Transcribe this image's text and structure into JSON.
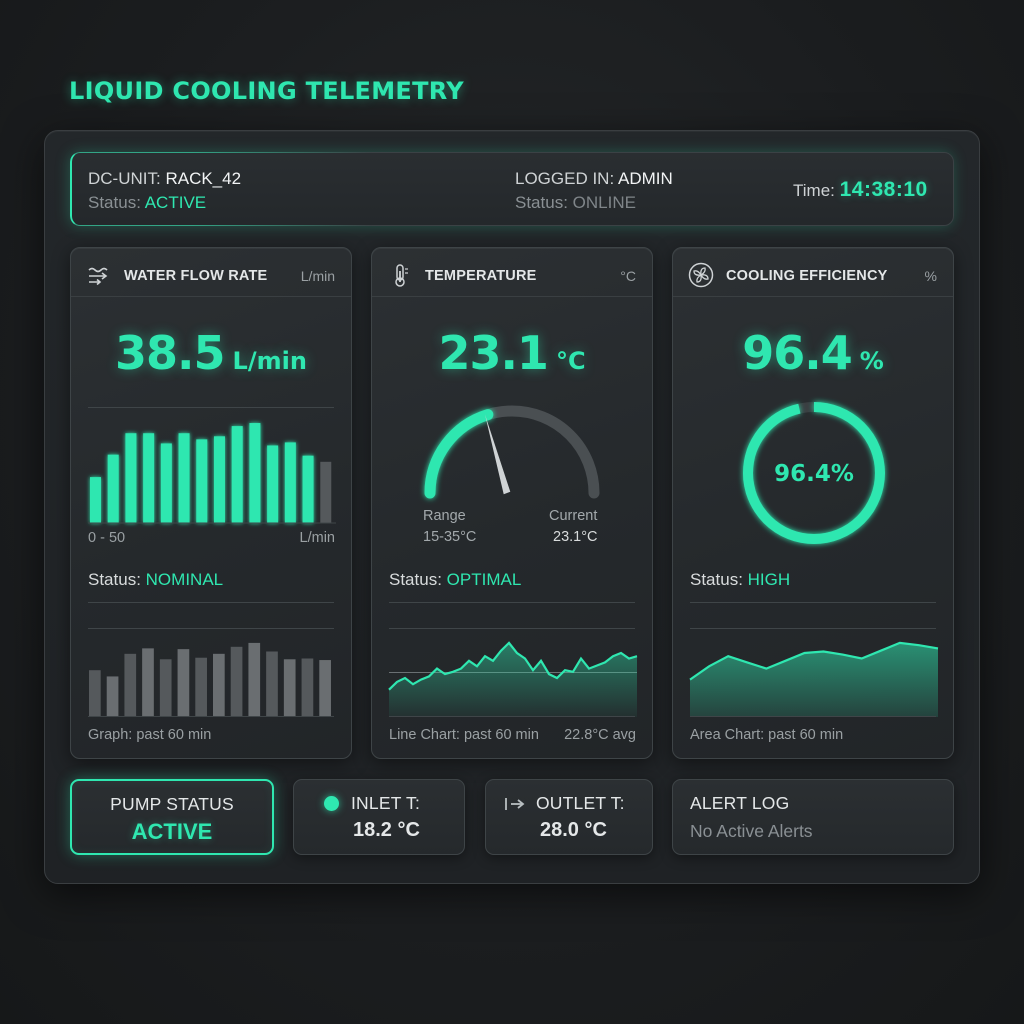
{
  "app": {
    "title": "LIQUID COOLING TELEMETRY"
  },
  "header": {
    "unit_label": "DC-UNIT:",
    "unit_value": "RACK_42",
    "status_label": "Status:",
    "status_value": "ACTIVE",
    "login_label": "LOGGED IN:",
    "login_value": "ADMIN",
    "login_status_label": "Status:",
    "login_status_value": "ONLINE",
    "time_label": "Time:",
    "time_value": "14:38:10"
  },
  "flow": {
    "title": "WATER FLOW RATE",
    "unit": "L/min",
    "value": "38.5",
    "value_unit": "L/min",
    "range_label": "0 - 50",
    "range_unit": "L/min",
    "status_label": "Status:",
    "status_value": "NOMINAL",
    "caption": "Graph: past 60 min",
    "bars_top": [
      0.45,
      0.67,
      0.88,
      0.88,
      0.78,
      0.88,
      0.82,
      0.85,
      0.95,
      0.98,
      0.76,
      0.79,
      0.66
    ],
    "bars_bottom": [
      0.6,
      0.52,
      0.81,
      0.88,
      0.74,
      0.87,
      0.76,
      0.81,
      0.9,
      0.95,
      0.84,
      0.74,
      0.75,
      0.73
    ]
  },
  "temperature": {
    "title": "TEMPERATURE",
    "unit": "°C",
    "value": "23.1",
    "value_unit": "°C",
    "range_label": "Range",
    "range_value": "15-35°C",
    "current_label": "Current",
    "current_value": "23.1°C",
    "gauge_min": 15,
    "gauge_max": 35,
    "gauge_current": 23.1,
    "status_label": "Status:",
    "status_value": "OPTIMAL",
    "caption": "Line Chart: past 60 min",
    "avg_label": "22.8°C avg",
    "line_series": [
      0.35,
      0.45,
      0.5,
      0.42,
      0.48,
      0.52,
      0.62,
      0.55,
      0.58,
      0.62,
      0.72,
      0.65,
      0.78,
      0.72,
      0.85,
      0.95,
      0.82,
      0.75,
      0.6,
      0.72,
      0.55,
      0.5,
      0.6,
      0.58,
      0.75,
      0.62,
      0.66,
      0.7,
      0.78,
      0.82,
      0.75,
      0.78
    ]
  },
  "efficiency": {
    "title": "COOLING EFFICIENCY",
    "unit": "%",
    "value": "96.4",
    "value_unit": "%",
    "ring_label": "96.4%",
    "ring_fraction": 0.964,
    "status_label": "Status:",
    "status_value": "HIGH",
    "caption": "Area Chart: past 60 min",
    "area_series": [
      0.48,
      0.65,
      0.78,
      0.7,
      0.62,
      0.72,
      0.82,
      0.84,
      0.8,
      0.75,
      0.85,
      0.95,
      0.92,
      0.88
    ]
  },
  "bottom": {
    "pump_label": "PUMP STATUS",
    "pump_value": "ACTIVE",
    "inlet_label": "INLET T:",
    "inlet_value": "18.2 °C",
    "outlet_label": "OUTLET T:",
    "outlet_value": "28.0 °C",
    "alert_label": "ALERT LOG",
    "alert_value": "No Active Alerts"
  },
  "icons": {
    "flow": "water-flow-icon",
    "temp": "thermometer-icon",
    "eff": "fan-icon",
    "inlet": "status-dot-icon",
    "outlet": "arrow-right-icon"
  },
  "colors": {
    "accent": "#2fe7b0",
    "bar_dim": "#55595c",
    "bar_dim_light": "#6a6e71"
  }
}
